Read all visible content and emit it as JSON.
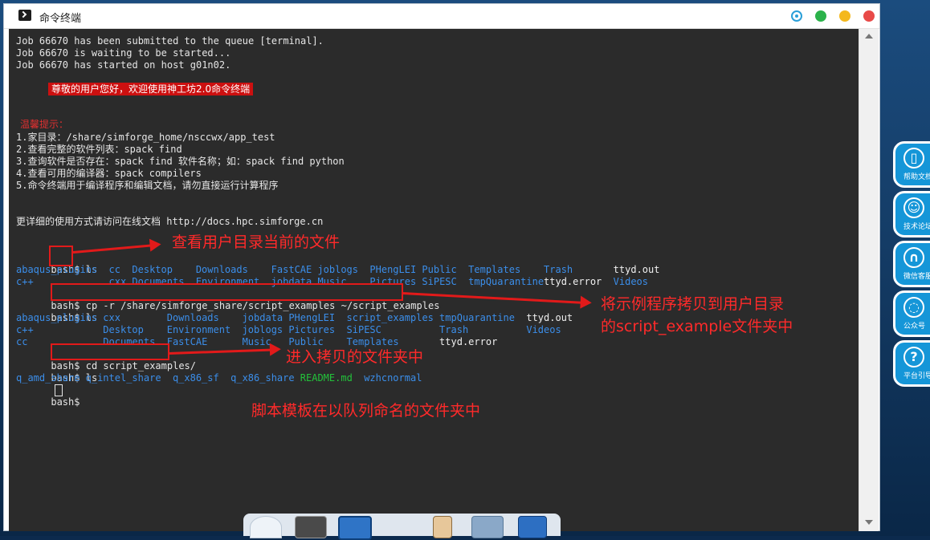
{
  "window": {
    "title": "命令终端"
  },
  "terminal": {
    "lines": {
      "l1": "Job 66670 has been submitted to the queue [terminal].",
      "l2": "Job 66670 is waiting to be started...",
      "l3": "Job 66670 has started on host g01n02.",
      "welcome": "尊敬的用户您好，欢迎使用神工坊2.0命令终端",
      "tips_title": "温馨提示：",
      "tip1": "1.家目录：/share/simforge_home/nsccwx/app_test",
      "tip2": "2.查看完整的软件列表：spack find",
      "tip3": "3.查询软件是否存在：spack find 软件名称；如：spack find python",
      "tip4": "4.查看可用的编译器：spack compilers",
      "tip5": "5.命令终端用于编译程序和编辑文档，请勿直接运行计算程序",
      "docs": "更详细的使用方式请访问在线文档 http://docs.hpc.simforge.cn",
      "prompt": "bash$ ",
      "cmd_ls": "ls",
      "cmd_cp": "cp -r /share/simforge_share/script_examples ~/script_examples",
      "cmd_cd": "cd script_examples/"
    },
    "ls1": {
      "row1": [
        "abaqus_plugins",
        "cc",
        "FastCAE",
        "jobdata",
        "Music",
        "Pictures",
        "SiPESC",
        "tmpQuarantine",
        "ttyd.error",
        "Videos"
      ],
      "row1_wait": "",
      "row_a": [
        "abaqus_plugins",
        "cc",
        "Desktop",
        "Downloads",
        "FastCAE",
        "joblogs",
        "PHengLEI",
        "Public",
        "Templates",
        "Trash",
        "ttyd.out"
      ],
      "row_b": [
        "c++",
        "cxx",
        "Documents",
        "Environment",
        "jobdata",
        "Music",
        "Pictures",
        "SiPESC",
        "tmpQuarantine",
        "ttyd.error",
        "Videos"
      ]
    },
    "ls2": {
      "row_a": [
        "abaqus_plugins",
        "cxx",
        "Downloads",
        "jobdata",
        "PHengLEI",
        "script_examples",
        "tmpQuarantine",
        "ttyd.out"
      ],
      "row_b": [
        "c++",
        "Desktop",
        "Environment",
        "joblogs",
        "Pictures",
        "SiPESC",
        "Trash",
        "Videos"
      ],
      "row_c": [
        "cc",
        "Documents",
        "FastCAE",
        "Music",
        "Public",
        "Templates",
        "ttyd.error"
      ]
    },
    "ls3": [
      "q_amd_share",
      "q_intel_share",
      "q_x86_sf",
      "q_x86_share",
      "README.md",
      "wzhcnormal"
    ]
  },
  "annotations": {
    "a1": "查看用户目录当前的文件",
    "a2_line1": "将示例程序拷贝到用户目录",
    "a2_line2": "的script_example文件夹中",
    "a3": "进入拷贝的文件夹中",
    "a4": "脚本模板在以队列命名的文件夹中"
  },
  "side_buttons": [
    {
      "label": "帮助文档",
      "icon": "book-icon"
    },
    {
      "label": "技术论坛",
      "icon": "forum-icon"
    },
    {
      "label": "微信客服",
      "icon": "headset-icon"
    },
    {
      "label": "公众号",
      "icon": "chat-icon"
    },
    {
      "label": "平台引导",
      "icon": "question-icon"
    }
  ],
  "colors": {
    "terminal_bg": "#2b2b2b",
    "dir_blue": "#3b8eea",
    "file_white": "#f0f0f0",
    "file_green": "#23c23a",
    "annotation_red": "#e21a1a",
    "welcome_bg": "#cc1010"
  }
}
